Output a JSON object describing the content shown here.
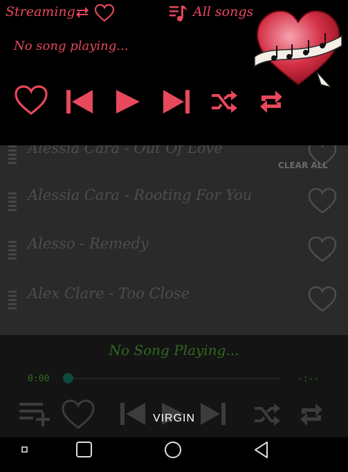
{
  "header": {
    "streaming_label": "Streaming",
    "all_songs_label": "All songs",
    "now_playing": "No song playing..."
  },
  "list": {
    "clear_all_label": "CLEAR ALL",
    "songs": [
      {
        "title": "Alessia Cara - Out Of Love"
      },
      {
        "title": "Alessia Cara - Rooting For You"
      },
      {
        "title": "Alesso - Remedy"
      },
      {
        "title": "Alex Clare - Too Close"
      }
    ]
  },
  "player": {
    "status": "No Song Playing...",
    "time_current": "0:00",
    "time_total": "-:--",
    "overlay_label": "VIRGIN"
  },
  "colors": {
    "accent": "#e8485c",
    "player_green": "#2e6b1e",
    "list_bg": "#2a2a2a"
  }
}
